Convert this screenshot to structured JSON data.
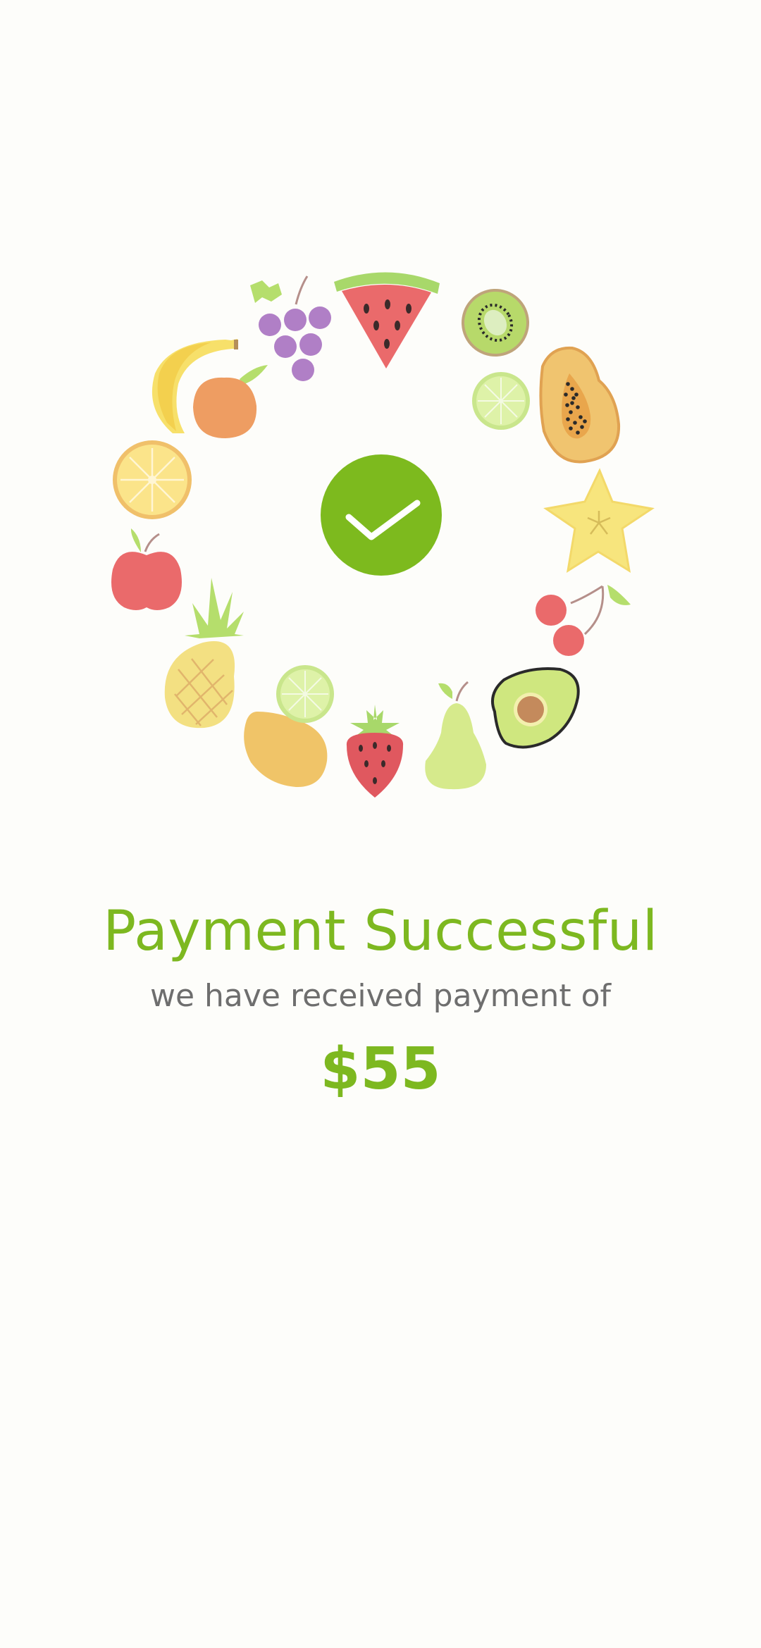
{
  "colors": {
    "background": "#fdfdfa",
    "accent": "#7db820",
    "check_circle": "#7dba1e",
    "subtitle_text": "#6e6e6e"
  },
  "status": {
    "icon": "check-icon",
    "title": "Payment Successful",
    "message": "we have received payment of",
    "amount": "$55"
  },
  "illustration": {
    "fruits": [
      "grapes-icon",
      "watermelon-icon",
      "kiwi-icon",
      "lime-slice-icon",
      "papaya-icon",
      "starfruit-icon",
      "cherries-icon",
      "avocado-icon",
      "pear-icon",
      "strawberry-icon",
      "mango-icon",
      "lime-slice-icon",
      "pineapple-icon",
      "apple-icon",
      "lemon-slice-icon",
      "banana-icon",
      "peach-icon"
    ]
  }
}
